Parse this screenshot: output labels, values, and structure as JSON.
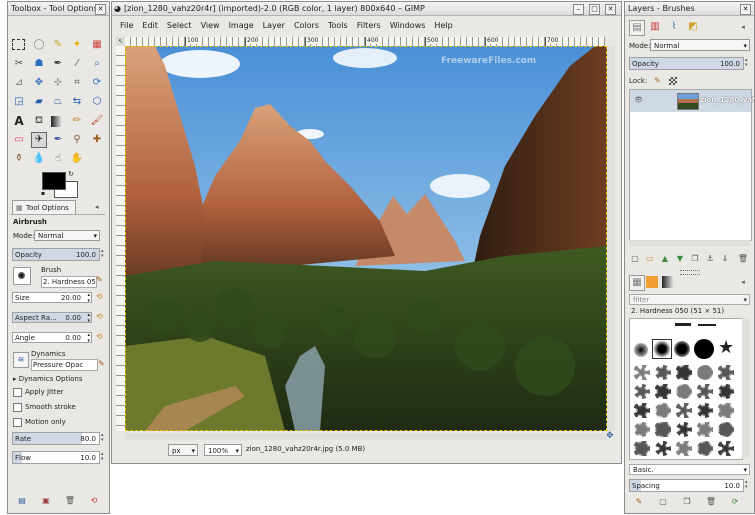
{
  "toolbox": {
    "title": "Toolbox - Tool Options",
    "tool_options_tab": "Tool Options",
    "tool_name": "Airbrush",
    "mode_label": "Mode:",
    "mode_value": "Normal",
    "opacity_label": "Opacity",
    "opacity_value": "100.0",
    "brush_label": "Brush",
    "brush_value": "2. Hardness 05",
    "size_label": "Size",
    "size_value": "20.00",
    "aspect_label": "Aspect Ra...",
    "aspect_value": "0.00",
    "angle_label": "Angle",
    "angle_value": "0.00",
    "dynamics_label": "Dynamics",
    "dynamics_value": "Pressure Opac",
    "dynamics_options": "Dynamics Options",
    "apply_jitter": "Apply Jitter",
    "smooth_stroke": "Smooth stroke",
    "motion_only": "Motion only",
    "rate_label": "Rate",
    "rate_value": "80.0",
    "rate_fraction": 0.8,
    "flow_label": "Flow",
    "flow_value": "10.0",
    "flow_fraction": 0.1
  },
  "image_window": {
    "title": "[zion_1280_vahz20r4r] (imported)-2.0 (RGB color, 1 layer) 800x640 – GIMP",
    "menu": [
      "File",
      "Edit",
      "Select",
      "View",
      "Image",
      "Layer",
      "Colors",
      "Tools",
      "Filters",
      "Windows",
      "Help"
    ],
    "ruler_ticks": [
      "100",
      "200",
      "300",
      "400",
      "500",
      "600",
      "700"
    ],
    "watermark": "FreewareFiles.com",
    "unit": "px",
    "zoom": "100%",
    "status": "zion_1280_vahz20r4r.jpg (5.0 MB)"
  },
  "layers": {
    "title": "Layers - Brushes",
    "mode_label": "Mode:",
    "mode_value": "Normal",
    "opacity_label": "Opacity",
    "opacity_value": "100.0",
    "lock_label": "Lock:",
    "layer_name": "zion_1280_vahz",
    "filter_placeholder": "filter",
    "brush_name": "2. Hardness 050 (51 × 51)",
    "brush_set": "Basic.",
    "spacing_label": "Spacing",
    "spacing_value": "10.0",
    "spacing_fraction": 0.1
  },
  "colors": {
    "panel": "#e9e8e4",
    "selection": "#cfd9e6",
    "foreground": "#000000",
    "background": "#ffffff"
  }
}
